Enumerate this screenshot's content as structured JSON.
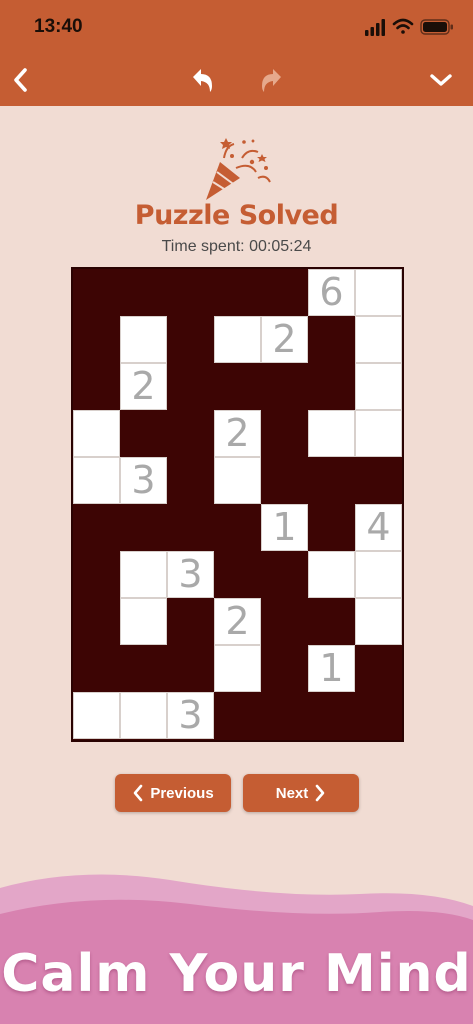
{
  "status_bar": {
    "time": "13:40"
  },
  "nav": {
    "back_icon": "chevron-left-icon",
    "undo_icon": "undo-icon",
    "redo_icon": "redo-icon",
    "collapse_icon": "chevron-down-icon"
  },
  "result": {
    "title": "Puzzle Solved",
    "time_label": "Time spent:",
    "time_value": "00:05:24"
  },
  "puzzle": {
    "rows": 10,
    "cols": 7,
    "white_cells": [
      [
        0,
        5
      ],
      [
        0,
        6
      ],
      [
        1,
        1
      ],
      [
        1,
        3
      ],
      [
        1,
        4
      ],
      [
        1,
        6
      ],
      [
        2,
        1
      ],
      [
        2,
        6
      ],
      [
        3,
        0
      ],
      [
        3,
        3
      ],
      [
        3,
        5
      ],
      [
        3,
        6
      ],
      [
        4,
        0
      ],
      [
        4,
        1
      ],
      [
        4,
        3
      ],
      [
        5,
        4
      ],
      [
        5,
        6
      ],
      [
        6,
        1
      ],
      [
        6,
        2
      ],
      [
        6,
        5
      ],
      [
        6,
        6
      ],
      [
        7,
        1
      ],
      [
        7,
        3
      ],
      [
        7,
        6
      ],
      [
        8,
        3
      ],
      [
        8,
        5
      ],
      [
        9,
        0
      ],
      [
        9,
        1
      ],
      [
        9,
        2
      ]
    ],
    "clues": [
      {
        "row": 0,
        "col": 5,
        "value": "6"
      },
      {
        "row": 1,
        "col": 4,
        "value": "2"
      },
      {
        "row": 2,
        "col": 1,
        "value": "2"
      },
      {
        "row": 3,
        "col": 3,
        "value": "2"
      },
      {
        "row": 4,
        "col": 1,
        "value": "3"
      },
      {
        "row": 5,
        "col": 4,
        "value": "1"
      },
      {
        "row": 5,
        "col": 6,
        "value": "4"
      },
      {
        "row": 6,
        "col": 2,
        "value": "3"
      },
      {
        "row": 7,
        "col": 3,
        "value": "2"
      },
      {
        "row": 8,
        "col": 5,
        "value": "1"
      },
      {
        "row": 9,
        "col": 2,
        "value": "3"
      }
    ],
    "colors": {
      "shaded": "#3d0504",
      "white": "#ffffff",
      "clue_text": "#a9a9a9"
    }
  },
  "buttons": {
    "previous_label": "Previous",
    "next_label": "Next"
  },
  "banner": {
    "tagline": "Calm Your Mind"
  },
  "theme": {
    "accent": "#c55d33",
    "background": "#f1dcd3",
    "wave": "#d882b0"
  }
}
